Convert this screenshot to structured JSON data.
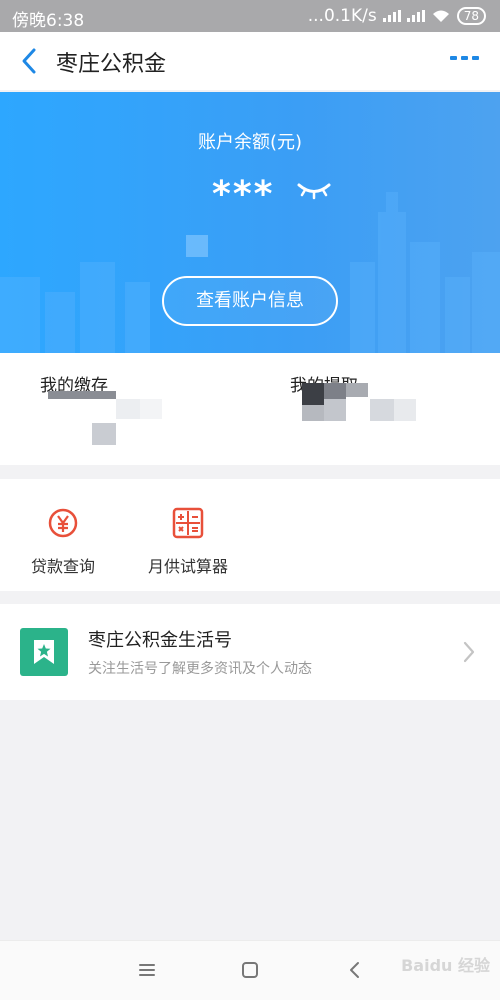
{
  "status_bar": {
    "time": "傍晚6:38",
    "network_speed": "...0.1K/s",
    "battery": "78",
    "icons": [
      "signal-icon",
      "signal-icon",
      "wifi-icon",
      "battery-icon"
    ]
  },
  "nav": {
    "title": "枣庄公积金",
    "back_icon": "back-chevron-icon",
    "more_icon": "more-dots-icon"
  },
  "account": {
    "balance_label": "账户余额(元)",
    "balance_masked": "***",
    "eye_icon": "eye-closed-icon",
    "view_button": "查看账户信息"
  },
  "stats": {
    "deposit_label": "我的缴存",
    "withdraw_label": "我的提取"
  },
  "tools": [
    {
      "label": "贷款查询",
      "icon": "loan-query-icon"
    },
    {
      "label": "月供试算器",
      "icon": "calculator-icon"
    }
  ],
  "life_account": {
    "title": "枣庄公积金生活号",
    "subtitle": "关注生活号了解更多资讯及个人动态",
    "icon": "bookmark-star-icon",
    "chevron": "chevron-right-icon"
  },
  "system_nav": {
    "icons": [
      "menu-icon",
      "home-icon",
      "back-icon"
    ]
  },
  "colors": {
    "accent_blue": "#2e9cf5",
    "tool_red": "#e8503a",
    "life_green": "#2bb38a"
  },
  "watermark": "Baidu 经验"
}
